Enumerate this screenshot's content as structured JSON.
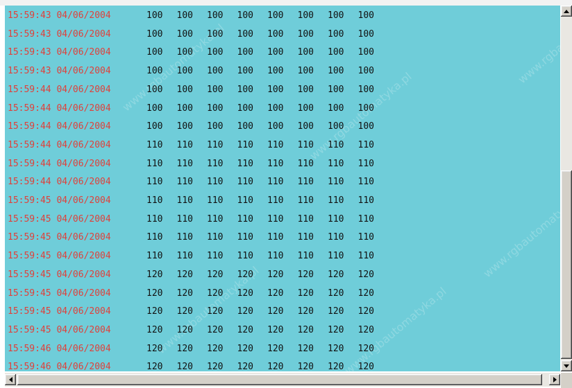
{
  "log": {
    "rows": [
      {
        "timestamp": "15:59:43 04/06/2004",
        "values": [
          "100",
          "100",
          "100",
          "100",
          "100",
          "100",
          "100",
          "100"
        ]
      },
      {
        "timestamp": "15:59:43 04/06/2004",
        "values": [
          "100",
          "100",
          "100",
          "100",
          "100",
          "100",
          "100",
          "100"
        ]
      },
      {
        "timestamp": "15:59:43 04/06/2004",
        "values": [
          "100",
          "100",
          "100",
          "100",
          "100",
          "100",
          "100",
          "100"
        ]
      },
      {
        "timestamp": "15:59:43 04/06/2004",
        "values": [
          "100",
          "100",
          "100",
          "100",
          "100",
          "100",
          "100",
          "100"
        ]
      },
      {
        "timestamp": "15:59:44 04/06/2004",
        "values": [
          "100",
          "100",
          "100",
          "100",
          "100",
          "100",
          "100",
          "100"
        ]
      },
      {
        "timestamp": "15:59:44 04/06/2004",
        "values": [
          "100",
          "100",
          "100",
          "100",
          "100",
          "100",
          "100",
          "100"
        ]
      },
      {
        "timestamp": "15:59:44 04/06/2004",
        "values": [
          "100",
          "100",
          "100",
          "100",
          "100",
          "100",
          "100",
          "100"
        ]
      },
      {
        "timestamp": "15:59:44 04/06/2004",
        "values": [
          "110",
          "110",
          "110",
          "110",
          "110",
          "110",
          "110",
          "110"
        ]
      },
      {
        "timestamp": "15:59:44 04/06/2004",
        "values": [
          "110",
          "110",
          "110",
          "110",
          "110",
          "110",
          "110",
          "110"
        ]
      },
      {
        "timestamp": "15:59:44 04/06/2004",
        "values": [
          "110",
          "110",
          "110",
          "110",
          "110",
          "110",
          "110",
          "110"
        ]
      },
      {
        "timestamp": "15:59:45 04/06/2004",
        "values": [
          "110",
          "110",
          "110",
          "110",
          "110",
          "110",
          "110",
          "110"
        ]
      },
      {
        "timestamp": "15:59:45 04/06/2004",
        "values": [
          "110",
          "110",
          "110",
          "110",
          "110",
          "110",
          "110",
          "110"
        ]
      },
      {
        "timestamp": "15:59:45 04/06/2004",
        "values": [
          "110",
          "110",
          "110",
          "110",
          "110",
          "110",
          "110",
          "110"
        ]
      },
      {
        "timestamp": "15:59:45 04/06/2004",
        "values": [
          "110",
          "110",
          "110",
          "110",
          "110",
          "110",
          "110",
          "110"
        ]
      },
      {
        "timestamp": "15:59:45 04/06/2004",
        "values": [
          "120",
          "120",
          "120",
          "120",
          "120",
          "120",
          "120",
          "120"
        ]
      },
      {
        "timestamp": "15:59:45 04/06/2004",
        "values": [
          "120",
          "120",
          "120",
          "120",
          "120",
          "120",
          "120",
          "120"
        ]
      },
      {
        "timestamp": "15:59:45 04/06/2004",
        "values": [
          "120",
          "120",
          "120",
          "120",
          "120",
          "120",
          "120",
          "120"
        ]
      },
      {
        "timestamp": "15:59:45 04/06/2004",
        "values": [
          "120",
          "120",
          "120",
          "120",
          "120",
          "120",
          "120",
          "120"
        ]
      },
      {
        "timestamp": "15:59:46 04/06/2004",
        "values": [
          "120",
          "120",
          "120",
          "120",
          "120",
          "120",
          "120",
          "120"
        ]
      },
      {
        "timestamp": "15:59:46 04/06/2004",
        "values": [
          "120",
          "120",
          "120",
          "120",
          "120",
          "120",
          "120",
          "120"
        ]
      }
    ]
  },
  "watermarks": [
    "www.rgbautomatyka.pl",
    "www.rgbautomatyka.pl",
    "www.rgbautomatyka.pl",
    "www.rgbautomatyka.pl",
    "www.rgbautomatyka.pl",
    "www.rgbautomatyka.pl"
  ],
  "colors": {
    "background": "#6fcdd9",
    "timestamp": "#e0403a",
    "value": "#111111"
  },
  "icons": {
    "scroll_up": "arrow-up-icon",
    "scroll_down": "arrow-down-icon",
    "scroll_left": "arrow-left-icon",
    "scroll_right": "arrow-right-icon"
  }
}
